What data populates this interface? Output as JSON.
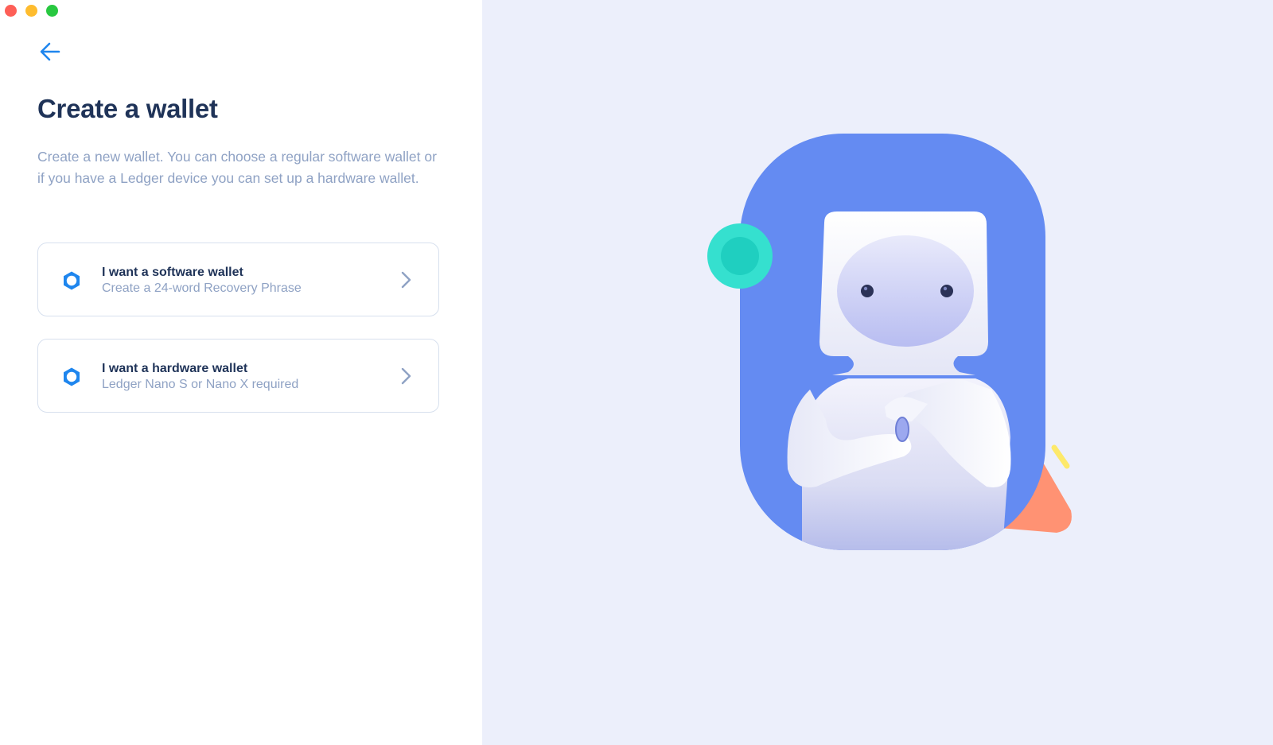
{
  "window": {
    "traffic_lights": [
      {
        "name": "close",
        "color": "#fe5f57"
      },
      {
        "name": "minimize",
        "color": "#febc2e"
      },
      {
        "name": "zoom",
        "color": "#28c840"
      }
    ]
  },
  "header": {
    "back_icon": "arrow-left-icon",
    "title": "Create a wallet",
    "description": "Create a new wallet. You can choose a regular software wallet or if you have a Ledger device you can set up a hardware wallet."
  },
  "options": [
    {
      "icon": "gear-icon",
      "title": "I want a software wallet",
      "subtitle": "Create a 24-word Recovery Phrase",
      "chevron": "chevron-right-icon"
    },
    {
      "icon": "gear-icon",
      "title": "I want a hardware wallet",
      "subtitle": "Ledger Nano S or Nano X required",
      "chevron": "chevron-right-icon"
    }
  ],
  "colors": {
    "accent": "#1f86ee",
    "title": "#1f3358",
    "muted": "#8fa2c4",
    "card_border": "#d7e0ee",
    "right_background": "#eceffb",
    "illustration_blue": "#648bf2",
    "illustration_teal": "#35e0cf",
    "illustration_coral": "#ff9273",
    "illustration_yellow": "#fde96a"
  },
  "illustration": {
    "name": "astronaut-illustration"
  }
}
